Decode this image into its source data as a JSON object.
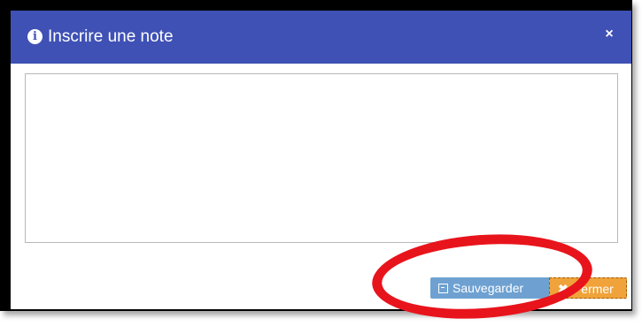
{
  "dialog": {
    "title": "Inscrire une note",
    "info_icon": "info-circle-icon",
    "close_icon_glyph": "×",
    "header_color": "#3f51b5"
  },
  "note": {
    "value": "",
    "placeholder": ""
  },
  "footer": {
    "save_label": "Sauvegarder",
    "save_icon": "floppy-disk-icon",
    "save_color": "#6ea1d1",
    "close_label": "Fermer",
    "close_icon": "times-icon",
    "close_color": "#f0a33a"
  },
  "annotation": {
    "highlight_color": "#e8141c"
  }
}
